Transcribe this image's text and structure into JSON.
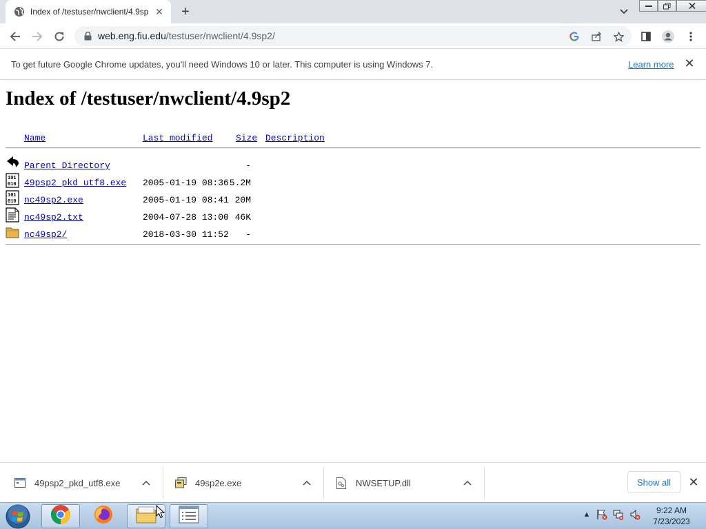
{
  "browser": {
    "tab_title": "Index of /testuser/nwclient/4.9sp",
    "url_host": "web.eng.fiu.edu",
    "url_path": "/testuser/nwclient/4.9sp2/",
    "window_controls": [
      "minimize",
      "restore",
      "close"
    ]
  },
  "infobar": {
    "message": "To get future Google Chrome updates, you'll need Windows 10 or later. This computer is using Windows 7.",
    "learn_more": "Learn more"
  },
  "page": {
    "title": "Index of /testuser/nwclient/4.9sp2",
    "columns": {
      "name": "Name",
      "last_modified": "Last modified",
      "size": "Size",
      "description": "Description"
    },
    "rows": [
      {
        "icon": "back-icon",
        "name": "Parent Directory",
        "modified": "",
        "size": "-"
      },
      {
        "icon": "binary-icon",
        "name": "49psp2_pkd_utf8.exe",
        "modified": "2005-01-19 08:36",
        "size": "5.2M"
      },
      {
        "icon": "binary-icon",
        "name": "nc49sp2.exe",
        "modified": "2005-01-19 08:41",
        "size": "20M"
      },
      {
        "icon": "text-file-icon",
        "name": "nc49sp2.txt",
        "modified": "2004-07-28 13:00",
        "size": "46K"
      },
      {
        "icon": "folder-icon",
        "name": "nc49sp2/",
        "modified": "2018-03-30 11:52",
        "size": "-"
      }
    ]
  },
  "downloads": {
    "items": [
      {
        "name": "49psp2_pkd_utf8.exe",
        "icon": "exe-file-icon"
      },
      {
        "name": "49sp2e.exe",
        "icon": "exe-file-icon"
      },
      {
        "name": "NWSETUP.dll",
        "icon": "dll-file-icon"
      }
    ],
    "show_all": "Show all"
  },
  "taskbar": {
    "apps": [
      "chrome-icon",
      "firefox-icon",
      "file-explorer-icon",
      "notepad-icon"
    ],
    "time": "9:22 AM",
    "date": "7/23/2023"
  },
  "colors": {
    "link": "#0000ee",
    "chrome_accent": "#1a73e8",
    "tabstrip": "#dee1e6"
  }
}
